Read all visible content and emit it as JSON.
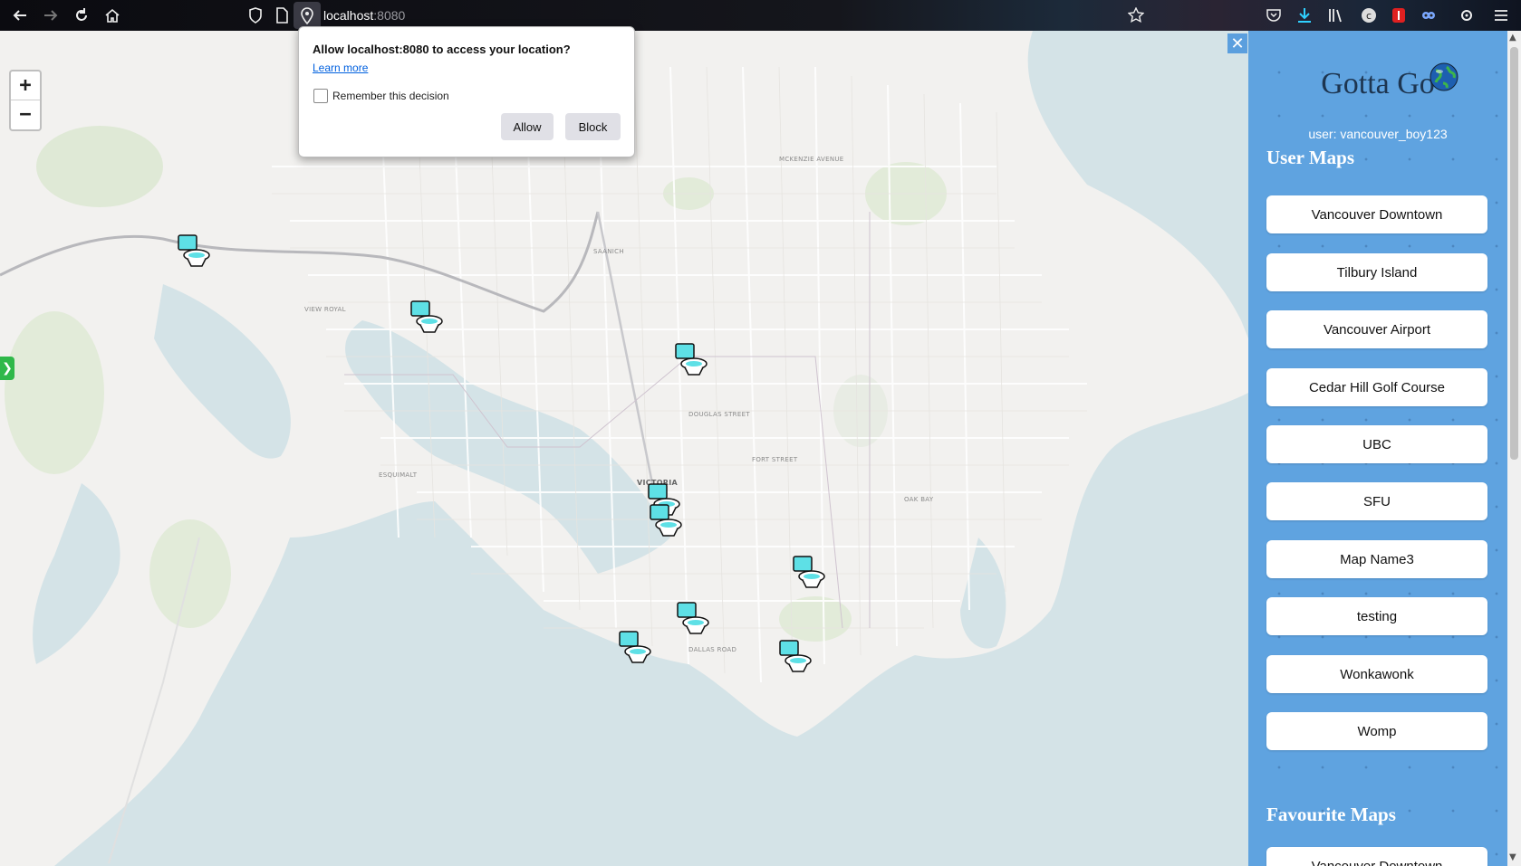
{
  "browser": {
    "url_host": "localhost",
    "url_port": ":8080",
    "icons": [
      "back-arrow-icon",
      "forward-arrow-icon",
      "reload-icon",
      "home-icon",
      "shield-icon",
      "page-icon",
      "location-pin-icon",
      "bookmark-star-icon",
      "pocket-icon",
      "download-icon",
      "library-icon",
      "extension-c-icon",
      "extension-red-icon",
      "extension-owl-icon",
      "extension-gear-icon",
      "menu-icon"
    ]
  },
  "permission_popup": {
    "question": "Allow localhost:8080 to access your location?",
    "learn_more": "Learn more",
    "remember_label": "Remember this decision",
    "remember_checked": false,
    "allow_label": "Allow",
    "block_label": "Block"
  },
  "map": {
    "zoom_in": "+",
    "zoom_out": "−",
    "side_tab": "❯",
    "center_label": "VICTORIA",
    "labels": [
      "ESQUIMALT",
      "VIEW ROYAL",
      "SAANICH",
      "OAK BAY",
      "MCKENZIE AVENUE",
      "DALLAS ROAD",
      "DOUGLAS STREET",
      "FORT STREET"
    ]
  },
  "sidebar": {
    "close": "✕",
    "title": "Gotta Go",
    "user_line": "user: vancouver_boy123",
    "user_maps_heading": "User Maps",
    "user_maps": [
      "Vancouver Downtown",
      "Tilbury Island",
      "Vancouver Airport",
      "Cedar Hill Golf Course",
      "UBC",
      "SFU",
      "Map Name3",
      "testing",
      "Wonkawonk",
      "Womp"
    ],
    "favourite_heading": "Favourite Maps",
    "favourite_maps": [
      "Vancouver Downtown"
    ]
  },
  "colors": {
    "sidebar_bg": "#5fa3e0",
    "title_color": "#1d3550",
    "water": "#d4e3e7",
    "land": "#f2f1ef",
    "marker_teal": "#5ee0e6"
  }
}
